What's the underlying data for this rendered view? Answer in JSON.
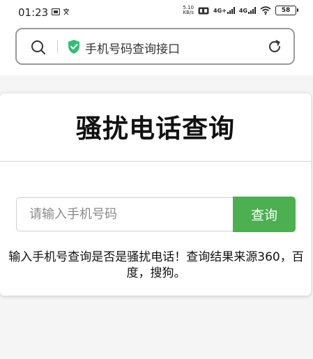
{
  "status_bar": {
    "time": "01:23",
    "left_icons": [
      "gallery-icon",
      "text-icon"
    ],
    "speed_value": "5.10",
    "speed_unit": "KB/s",
    "network_1": "4G+",
    "network_2": "4G",
    "battery": "58"
  },
  "address_bar": {
    "title": "手机号码查询接口",
    "search_icon": "search-icon",
    "secure_icon": "shield-check-icon",
    "reload_icon": "reload-icon"
  },
  "main": {
    "title": "骚扰电话查询",
    "input_placeholder": "请输入手机号码",
    "input_value": "",
    "button_label": "查询",
    "description": "输入手机号查询是否是骚扰电话！查询结果来源360，百度，搜狗。"
  },
  "colors": {
    "accent_green": "#4caf50",
    "shield_green": "#2fbf71"
  }
}
